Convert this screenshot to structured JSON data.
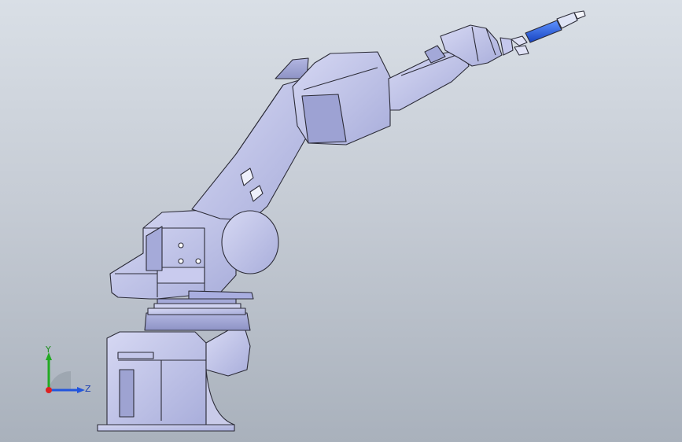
{
  "triad": {
    "y_label": "Y",
    "z_label": "Z",
    "y_color": "#22aa22",
    "z_color": "#2255dd",
    "x_color": "#dd2222"
  },
  "model": {
    "fill_main": "#b9bde8",
    "fill_light": "#d2d5f1",
    "fill_dark": "#9a9fd0",
    "edge": "#2c2c38",
    "tool_color": "#1e5fe0"
  }
}
